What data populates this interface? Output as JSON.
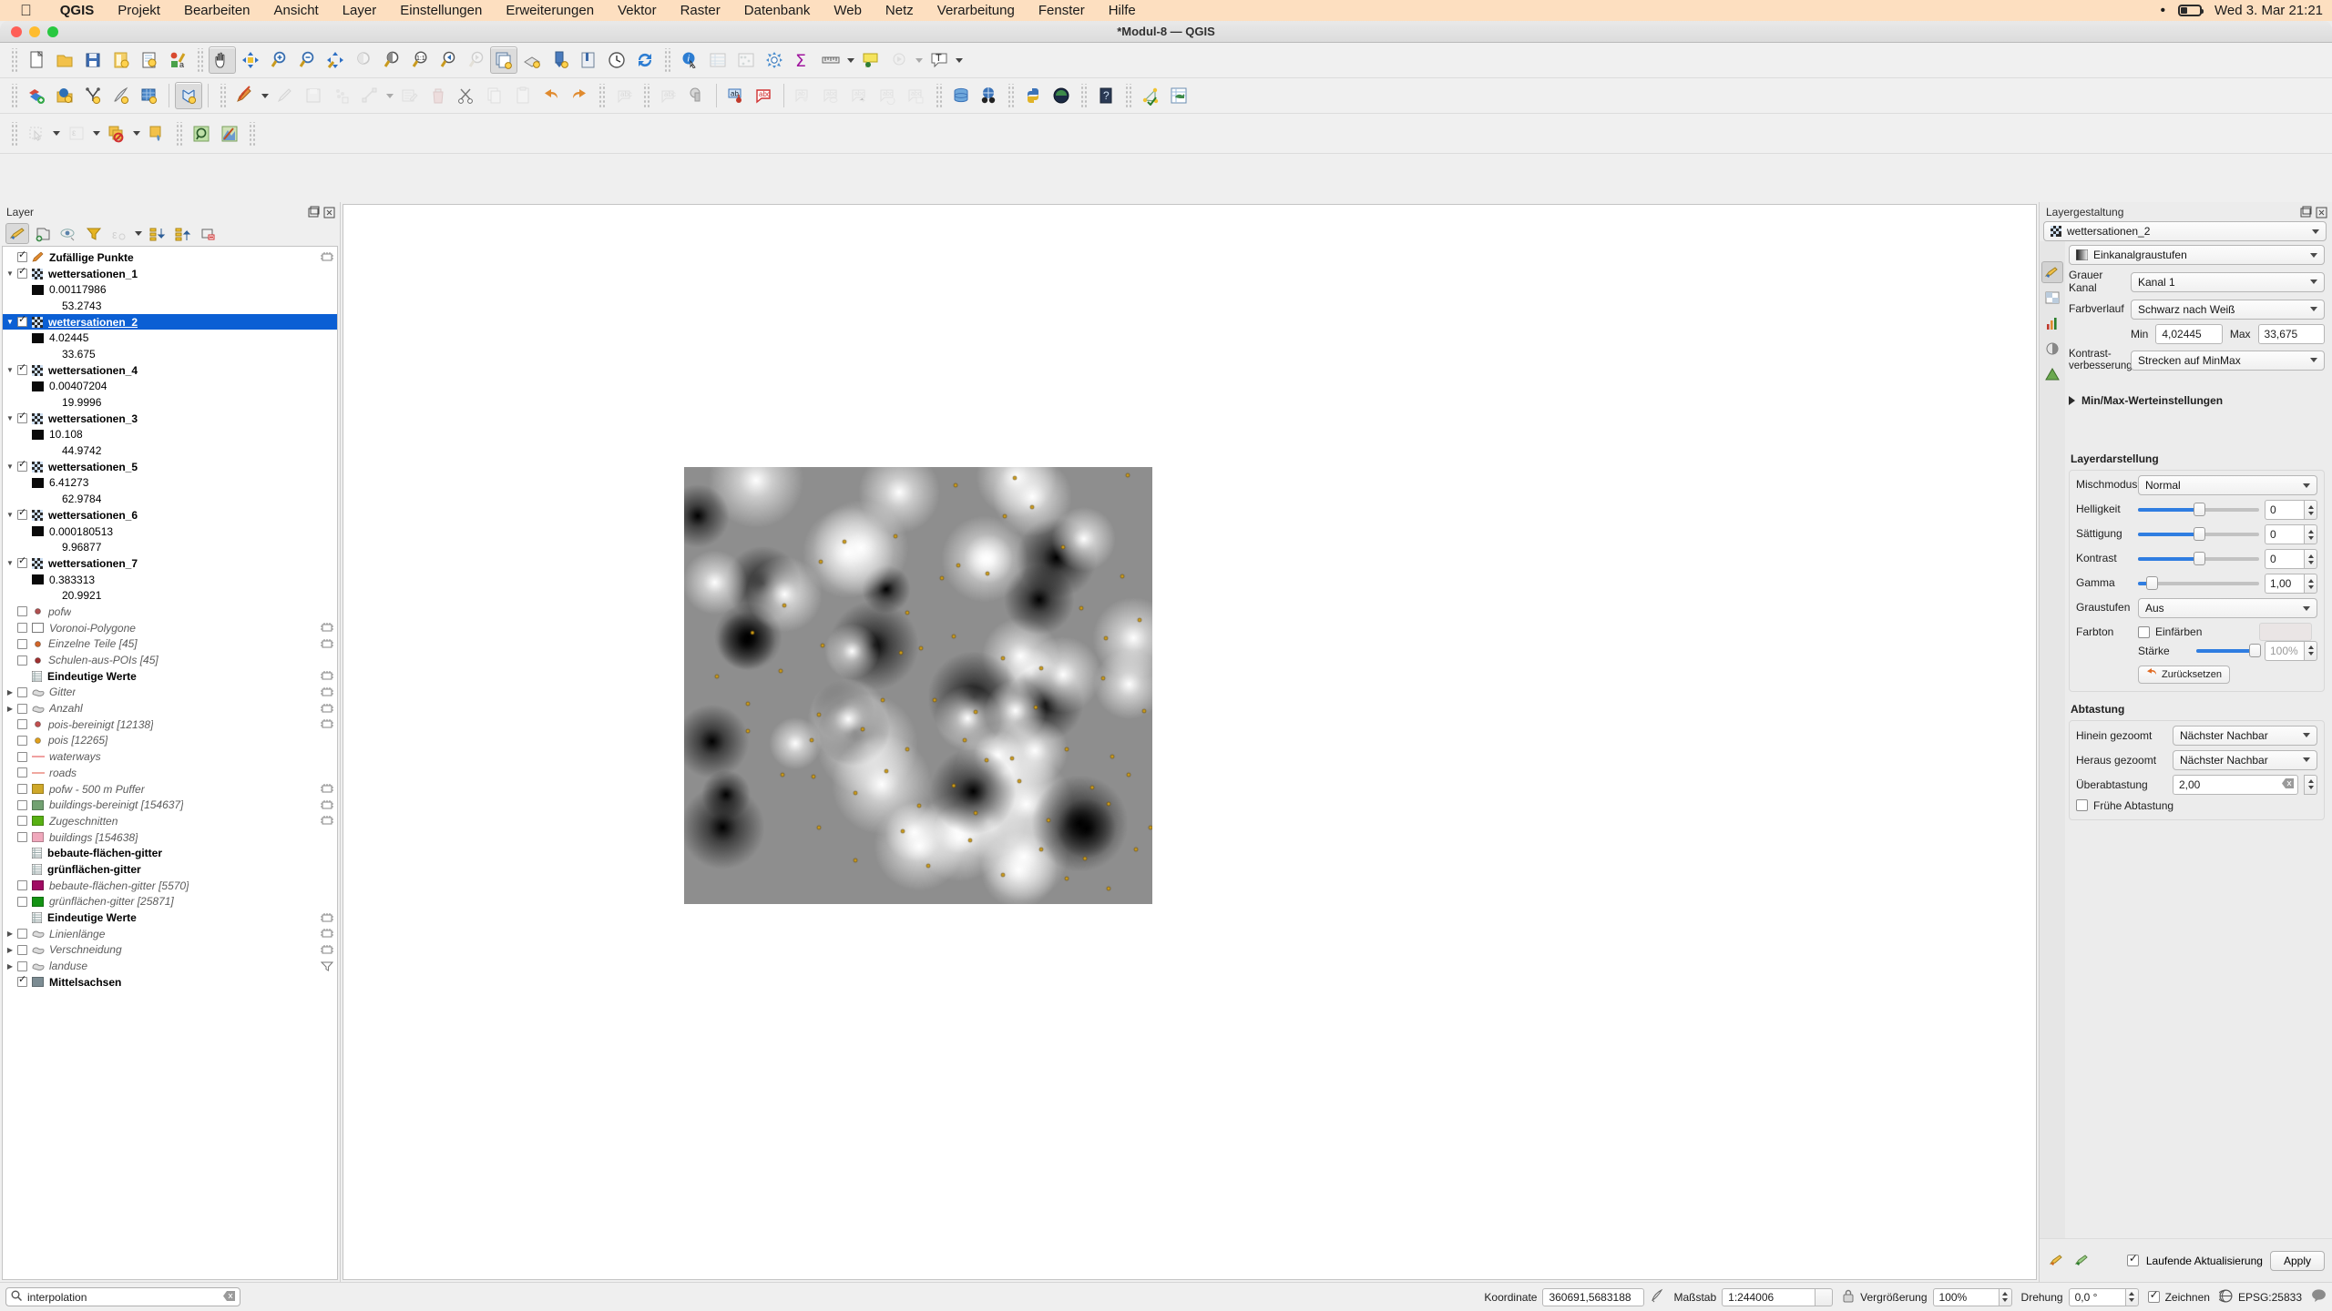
{
  "macbar": {
    "app": "QGIS",
    "menus": [
      "Projekt",
      "Bearbeiten",
      "Ansicht",
      "Layer",
      "Einstellungen",
      "Erweiterungen",
      "Vektor",
      "Raster",
      "Datenbank",
      "Web",
      "Netz",
      "Verarbeitung",
      "Fenster",
      "Hilfe"
    ],
    "clock": "Wed 3. Mar  21:21"
  },
  "window": {
    "title": "*Modul-8 — QGIS"
  },
  "layers_panel": {
    "title": "Layer",
    "toolbar_icons": [
      "open-styling-panel-icon",
      "add-group-icon",
      "manage-visibility-icon",
      "filter-legend-icon",
      "filter-legend-expression-icon",
      "expand-all-icon",
      "collapse-all-icon",
      "remove-layer-icon"
    ],
    "items": [
      {
        "label": "Zufällige Punkte",
        "indent": 1,
        "checked": true,
        "style": "bold",
        "icon": "edit-pencil-icon",
        "twisty": "",
        "end_icon": "processing-icon"
      },
      {
        "label": "wettersationen_1",
        "indent": 1,
        "checked": true,
        "style": "bold",
        "icon": "raster-icon",
        "twisty": "down",
        "end_icon": ""
      },
      {
        "label": "0.00117986",
        "indent": 2,
        "checked": null,
        "style": "normal",
        "icon": "black-swatch",
        "twisty": "",
        "end_icon": ""
      },
      {
        "label": "53.2743",
        "indent": 3,
        "checked": null,
        "style": "normal",
        "icon": "",
        "twisty": "",
        "end_icon": ""
      },
      {
        "label": "wettersationen_2",
        "indent": 1,
        "checked": true,
        "style": "selected",
        "icon": "raster-icon",
        "twisty": "down",
        "end_icon": ""
      },
      {
        "label": "4.02445",
        "indent": 2,
        "checked": null,
        "style": "normal",
        "icon": "black-swatch",
        "twisty": "",
        "end_icon": ""
      },
      {
        "label": "33.675",
        "indent": 3,
        "checked": null,
        "style": "normal",
        "icon": "",
        "twisty": "",
        "end_icon": ""
      },
      {
        "label": "wettersationen_4",
        "indent": 1,
        "checked": true,
        "style": "bold",
        "icon": "raster-icon",
        "twisty": "down",
        "end_icon": ""
      },
      {
        "label": "0.00407204",
        "indent": 2,
        "checked": null,
        "style": "normal",
        "icon": "black-swatch",
        "twisty": "",
        "end_icon": ""
      },
      {
        "label": "19.9996",
        "indent": 3,
        "checked": null,
        "style": "normal",
        "icon": "",
        "twisty": "",
        "end_icon": ""
      },
      {
        "label": "wettersationen_3",
        "indent": 1,
        "checked": true,
        "style": "bold",
        "icon": "raster-icon",
        "twisty": "down",
        "end_icon": ""
      },
      {
        "label": "10.108",
        "indent": 2,
        "checked": null,
        "style": "normal",
        "icon": "black-swatch",
        "twisty": "",
        "end_icon": ""
      },
      {
        "label": "44.9742",
        "indent": 3,
        "checked": null,
        "style": "normal",
        "icon": "",
        "twisty": "",
        "end_icon": ""
      },
      {
        "label": "wettersationen_5",
        "indent": 1,
        "checked": true,
        "style": "bold",
        "icon": "raster-icon",
        "twisty": "down",
        "end_icon": ""
      },
      {
        "label": "6.41273",
        "indent": 2,
        "checked": null,
        "style": "normal",
        "icon": "black-swatch",
        "twisty": "",
        "end_icon": ""
      },
      {
        "label": "62.9784",
        "indent": 3,
        "checked": null,
        "style": "normal",
        "icon": "",
        "twisty": "",
        "end_icon": ""
      },
      {
        "label": "wettersationen_6",
        "indent": 1,
        "checked": true,
        "style": "bold",
        "icon": "raster-icon",
        "twisty": "down",
        "end_icon": ""
      },
      {
        "label": "0.000180513",
        "indent": 2,
        "checked": null,
        "style": "normal",
        "icon": "black-swatch",
        "twisty": "",
        "end_icon": ""
      },
      {
        "label": "9.96877",
        "indent": 3,
        "checked": null,
        "style": "normal",
        "icon": "",
        "twisty": "",
        "end_icon": ""
      },
      {
        "label": "wettersationen_7",
        "indent": 1,
        "checked": true,
        "style": "bold",
        "icon": "raster-icon",
        "twisty": "down",
        "end_icon": ""
      },
      {
        "label": "0.383313",
        "indent": 2,
        "checked": null,
        "style": "normal",
        "icon": "black-swatch",
        "twisty": "",
        "end_icon": ""
      },
      {
        "label": "20.9921",
        "indent": 3,
        "checked": null,
        "style": "normal",
        "icon": "",
        "twisty": "",
        "end_icon": ""
      },
      {
        "label": "pofw",
        "indent": 1,
        "checked": false,
        "style": "italic",
        "icon": "point-icon",
        "point_color": "#b05050",
        "twisty": "",
        "end_icon": ""
      },
      {
        "label": "Voronoi-Polygone",
        "indent": 1,
        "checked": false,
        "style": "italic",
        "icon": "polygon-outline-icon",
        "twisty": "",
        "end_icon": "processing-icon"
      },
      {
        "label": "Einzelne Teile [45]",
        "indent": 1,
        "checked": false,
        "style": "italic",
        "icon": "point-icon",
        "point_color": "#d2662a",
        "twisty": "",
        "end_icon": "processing-icon"
      },
      {
        "label": "Schulen-aus-POIs [45]",
        "indent": 1,
        "checked": false,
        "style": "italic",
        "icon": "point-icon",
        "point_color": "#a03030",
        "twisty": "",
        "end_icon": ""
      },
      {
        "label": "Eindeutige Werte",
        "indent": 1,
        "checked": null,
        "style": "bold",
        "icon": "table-icon",
        "twisty": "",
        "end_icon": "processing-icon"
      },
      {
        "label": "Gitter",
        "indent": 1,
        "checked": false,
        "style": "italic",
        "icon": "poly-gray-icon",
        "twisty": "right",
        "end_icon": "processing-icon"
      },
      {
        "label": "Anzahl",
        "indent": 1,
        "checked": false,
        "style": "italic",
        "icon": "poly-gray-icon",
        "twisty": "right",
        "end_icon": "processing-icon"
      },
      {
        "label": "pois-bereinigt [12138]",
        "indent": 1,
        "checked": false,
        "style": "italic",
        "icon": "point-icon",
        "point_color": "#c25050",
        "twisty": "",
        "end_icon": "processing-icon"
      },
      {
        "label": "pois [12265]",
        "indent": 1,
        "checked": false,
        "style": "italic",
        "icon": "point-icon",
        "point_color": "#e0a01c",
        "twisty": "",
        "end_icon": ""
      },
      {
        "label": "waterways",
        "indent": 1,
        "checked": false,
        "style": "italic",
        "icon": "line-icon",
        "point_color": "#f0a0a0",
        "twisty": "",
        "end_icon": ""
      },
      {
        "label": "roads",
        "indent": 1,
        "checked": false,
        "style": "italic",
        "icon": "line-icon",
        "point_color": "#f0a8a0",
        "twisty": "",
        "end_icon": ""
      },
      {
        "label": "pofw - 500 m Puffer",
        "indent": 1,
        "checked": false,
        "style": "italic",
        "icon": "fill-swatch",
        "point_color": "#cfa829",
        "twisty": "",
        "end_icon": "processing-icon"
      },
      {
        "label": "buildings-bereinigt [154637]",
        "indent": 1,
        "checked": false,
        "style": "italic",
        "icon": "fill-swatch",
        "point_color": "#72a172",
        "twisty": "",
        "end_icon": "processing-icon"
      },
      {
        "label": "Zugeschnitten",
        "indent": 1,
        "checked": false,
        "style": "italic",
        "icon": "fill-swatch",
        "point_color": "#58b013",
        "twisty": "",
        "end_icon": "processing-icon"
      },
      {
        "label": "buildings [154638]",
        "indent": 1,
        "checked": false,
        "style": "italic",
        "icon": "fill-swatch",
        "point_color": "#f0a8bc",
        "twisty": "",
        "end_icon": ""
      },
      {
        "label": "bebaute-flächen-gitter",
        "indent": 1,
        "checked": null,
        "style": "bold",
        "icon": "table-icon",
        "twisty": "",
        "end_icon": ""
      },
      {
        "label": "grünflächen-gitter",
        "indent": 1,
        "checked": null,
        "style": "bold",
        "icon": "table-icon",
        "twisty": "",
        "end_icon": ""
      },
      {
        "label": "bebaute-flächen-gitter [5570]",
        "indent": 1,
        "checked": false,
        "style": "italic",
        "icon": "fill-swatch",
        "point_color": "#a00b63",
        "twisty": "",
        "end_icon": ""
      },
      {
        "label": "grünflächen-gitter [25871]",
        "indent": 1,
        "checked": false,
        "style": "italic",
        "icon": "fill-swatch",
        "point_color": "#149314",
        "twisty": "",
        "end_icon": ""
      },
      {
        "label": "Eindeutige Werte",
        "indent": 1,
        "checked": null,
        "style": "bold",
        "icon": "table-icon",
        "twisty": "",
        "end_icon": "processing-icon"
      },
      {
        "label": "Linienlänge",
        "indent": 1,
        "checked": false,
        "style": "italic",
        "icon": "poly-gray-icon",
        "twisty": "right",
        "end_icon": "processing-icon"
      },
      {
        "label": "Verschneidung",
        "indent": 1,
        "checked": false,
        "style": "italic",
        "icon": "poly-gray-icon",
        "twisty": "right",
        "end_icon": "processing-icon"
      },
      {
        "label": "landuse",
        "indent": 1,
        "checked": false,
        "style": "italic",
        "icon": "poly-gray-icon",
        "twisty": "right",
        "end_icon": "filter-icon"
      },
      {
        "label": "Mittelsachsen",
        "indent": 1,
        "checked": true,
        "style": "bold",
        "icon": "fill-swatch",
        "point_color": "#7c8c93",
        "twisty": "",
        "end_icon": ""
      }
    ]
  },
  "style_panel": {
    "title": "Layergestaltung",
    "layer_selector": "wettersationen_2",
    "tabs": [
      "symbology-tab",
      "transparency-tab",
      "histogram-tab",
      "rendering-tab",
      "pyramids-tab"
    ],
    "renderer": "Einkanalgraustufen",
    "rows": [
      {
        "label": "Grauer Kanal",
        "value": "Kanal 1"
      },
      {
        "label": "Farbverlauf",
        "value": "Schwarz nach Weiß"
      }
    ],
    "min_label": "Min",
    "min_value": "4,02445",
    "max_label": "Max",
    "max_value": "33,675",
    "contrast_label": "Kontrast-\nverbesserung",
    "contrast_label_l1": "Kontrast-",
    "contrast_label_l2": "verbesserung",
    "contrast_value": "Strecken auf MinMax",
    "minmax_section": "Min/Max-Werteinstellungen",
    "render_group": "Layerdarstellung",
    "blend_label": "Mischmodus",
    "blend_value": "Normal",
    "sliders": [
      {
        "label": "Helligkeit",
        "value": "0",
        "pct": 50
      },
      {
        "label": "Sättigung",
        "value": "0",
        "pct": 50
      },
      {
        "label": "Kontrast",
        "value": "0",
        "pct": 50
      },
      {
        "label": "Gamma",
        "value": "1,00",
        "pct": 11
      }
    ],
    "gray_label": "Graustufen",
    "gray_value": "Aus",
    "hue_label": "Farbton",
    "colorize_label": "Einfärben",
    "colorize_checked": false,
    "strength_label": "Stärke",
    "strength_value": "100%",
    "strength_pct": 93,
    "reset_label": "Zurücksetzen",
    "resample_group": "Abtastung",
    "zoom_in_label": "Hinein gezoomt",
    "zoom_in_value": "Nächster Nachbar",
    "zoom_out_label": "Heraus gezoomt",
    "zoom_out_value": "Nächster Nachbar",
    "oversample_label": "Überabtastung",
    "oversample_value": "2,00",
    "early_resample_label": "Frühe Abtastung",
    "early_resample_checked": false,
    "live_update_label": "Laufende Aktualisierung",
    "live_update_checked": true,
    "apply_label": "Apply"
  },
  "status_bar": {
    "search_value": "interpolation",
    "coordinate_label": "Koordinate",
    "coordinate_value": "360691,5683188",
    "scale_label": "Maßstab",
    "scale_value": "1:244006",
    "magnify_label": "Vergrößerung",
    "magnify_value": "100%",
    "rotation_label": "Drehung",
    "rotation_value": "0,0 °",
    "render_label": "Zeichnen",
    "render_checked": true,
    "crs_label": "EPSG:25833"
  },
  "map": {
    "raster_title": "wettersationen_2-interpolation-grayscale",
    "background": "#8e8e8e",
    "point_color": "#d4a017",
    "points": [
      [
        298,
        20,
        1
      ],
      [
        363,
        12,
        1
      ],
      [
        487,
        9,
        1
      ],
      [
        176,
        82,
        0
      ],
      [
        352,
        54,
        1
      ],
      [
        382,
        44,
        0
      ],
      [
        232,
        76,
        1
      ],
      [
        150,
        104,
        1
      ],
      [
        543,
        44,
        1
      ],
      [
        283,
        122,
        1
      ],
      [
        301,
        108,
        0
      ],
      [
        481,
        120,
        1
      ],
      [
        416,
        88,
        1
      ],
      [
        75,
        182,
        1
      ],
      [
        110,
        152,
        1
      ],
      [
        245,
        160,
        0
      ],
      [
        333,
        117,
        1
      ],
      [
        436,
        155,
        1
      ],
      [
        500,
        168,
        0
      ],
      [
        152,
        196,
        1
      ],
      [
        260,
        199,
        1
      ],
      [
        296,
        186,
        0
      ],
      [
        350,
        210,
        1
      ],
      [
        392,
        221,
        1
      ],
      [
        463,
        188,
        0
      ],
      [
        36,
        230,
        1
      ],
      [
        106,
        224,
        1
      ],
      [
        238,
        204,
        1
      ],
      [
        460,
        232,
        0
      ],
      [
        520,
        219,
        1
      ],
      [
        540,
        248,
        1
      ],
      [
        70,
        260,
        1
      ],
      [
        148,
        272,
        1
      ],
      [
        218,
        256,
        1
      ],
      [
        275,
        256,
        0
      ],
      [
        320,
        269,
        1
      ],
      [
        386,
        264,
        1
      ],
      [
        505,
        268,
        1
      ],
      [
        70,
        290,
        1
      ],
      [
        140,
        300,
        0
      ],
      [
        196,
        288,
        1
      ],
      [
        245,
        310,
        1
      ],
      [
        308,
        300,
        1
      ],
      [
        360,
        320,
        0
      ],
      [
        420,
        310,
        1
      ],
      [
        470,
        318,
        1
      ],
      [
        332,
        322,
        1
      ],
      [
        142,
        340,
        1
      ],
      [
        222,
        334,
        1
      ],
      [
        296,
        350,
        0
      ],
      [
        368,
        345,
        1
      ],
      [
        448,
        352,
        1
      ],
      [
        488,
        338,
        1
      ],
      [
        188,
        358,
        1
      ],
      [
        258,
        372,
        1
      ],
      [
        320,
        380,
        0
      ],
      [
        400,
        388,
        1
      ],
      [
        466,
        370,
        1
      ],
      [
        108,
        338,
        1
      ],
      [
        512,
        396,
        1
      ],
      [
        148,
        396,
        1
      ],
      [
        240,
        400,
        1
      ],
      [
        314,
        410,
        0
      ],
      [
        392,
        420,
        1
      ],
      [
        440,
        430,
        1
      ],
      [
        496,
        420,
        1
      ],
      [
        188,
        432,
        1
      ],
      [
        268,
        438,
        1
      ],
      [
        350,
        448,
        1
      ],
      [
        420,
        452,
        0
      ],
      [
        466,
        463,
        1
      ]
    ]
  }
}
